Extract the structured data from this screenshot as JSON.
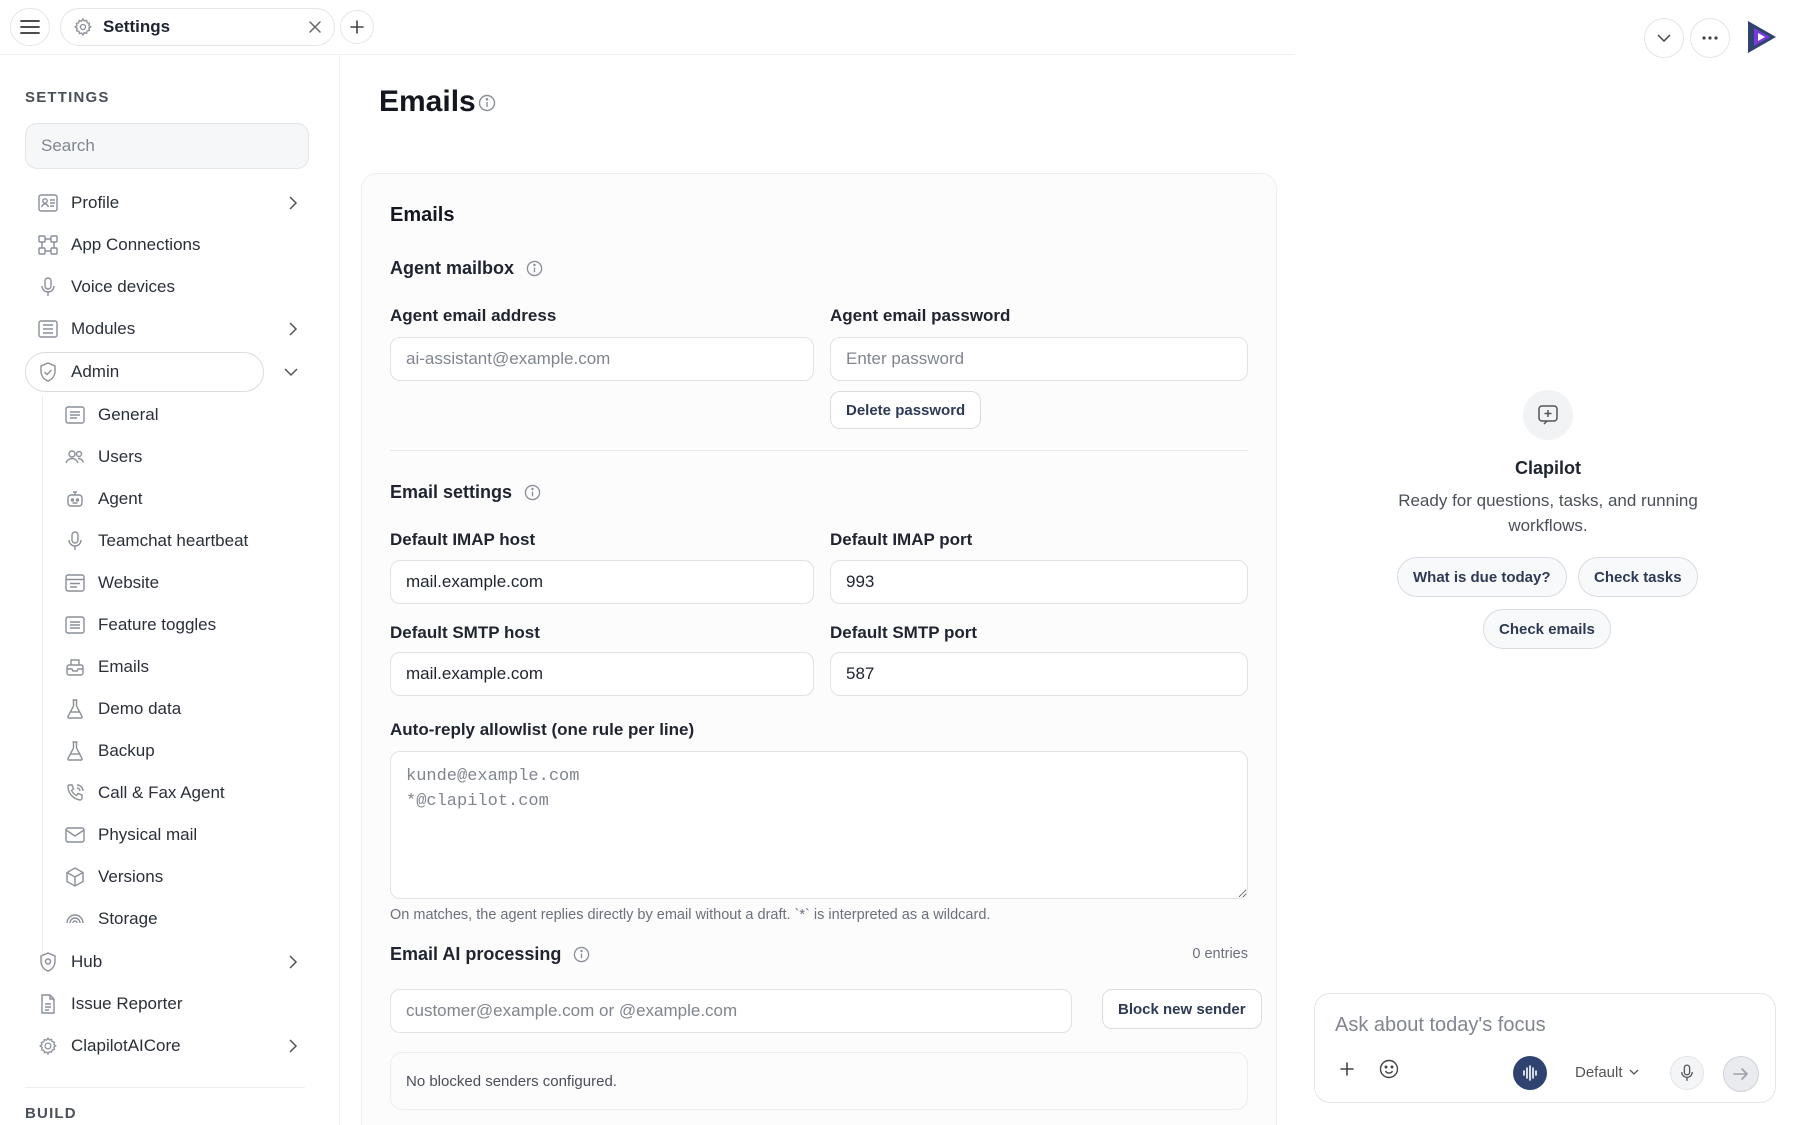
{
  "tab": {
    "label": "Settings"
  },
  "sidebar": {
    "heading": "SETTINGS",
    "search_placeholder": "Search",
    "items": [
      {
        "label": "Profile"
      },
      {
        "label": "App Connections"
      },
      {
        "label": "Voice devices"
      },
      {
        "label": "Modules"
      },
      {
        "label": "Admin"
      },
      {
        "label": "General"
      },
      {
        "label": "Users"
      },
      {
        "label": "Agent"
      },
      {
        "label": "Teamchat heartbeat"
      },
      {
        "label": "Website"
      },
      {
        "label": "Feature toggles"
      },
      {
        "label": "Emails"
      },
      {
        "label": "Demo data"
      },
      {
        "label": "Backup"
      },
      {
        "label": "Call & Fax Agent"
      },
      {
        "label": "Physical mail"
      },
      {
        "label": "Versions"
      },
      {
        "label": "Storage"
      },
      {
        "label": "Hub"
      },
      {
        "label": "Issue Reporter"
      },
      {
        "label": "ClapilotAICore"
      }
    ],
    "build_heading": "BUILD"
  },
  "main": {
    "page_title": "Emails",
    "card_title": "Emails",
    "agent_mailbox": {
      "label": "Agent mailbox",
      "email_label": "Agent email address",
      "email_placeholder": "ai-assistant@example.com",
      "password_label": "Agent email password",
      "password_placeholder": "Enter password",
      "delete_password": "Delete password"
    },
    "email_settings": {
      "label": "Email settings",
      "imap_host_label": "Default IMAP host",
      "imap_host_value": "mail.example.com",
      "imap_port_label": "Default IMAP port",
      "imap_port_value": "993",
      "smtp_host_label": "Default SMTP host",
      "smtp_host_value": "mail.example.com",
      "smtp_port_label": "Default SMTP port",
      "smtp_port_value": "587",
      "allowlist_label": "Auto-reply allowlist (one rule per line)",
      "allowlist_placeholder": "kunde@example.com\n*@clapilot.com",
      "allowlist_hint": "On matches, the agent replies directly by email without a draft. `*` is interpreted as a wildcard."
    },
    "ai_processing": {
      "label": "Email AI processing",
      "entries": "0 entries",
      "input_placeholder": "customer@example.com or @example.com",
      "block_button": "Block new sender",
      "empty_text": "No blocked senders configured."
    }
  },
  "assistant": {
    "name": "Clapilot",
    "description": "Ready for questions, tasks, and running workflows.",
    "chips": [
      "What is due today?",
      "Check tasks",
      "Check emails"
    ],
    "composer_placeholder": "Ask about today's focus",
    "model": "Default"
  }
}
